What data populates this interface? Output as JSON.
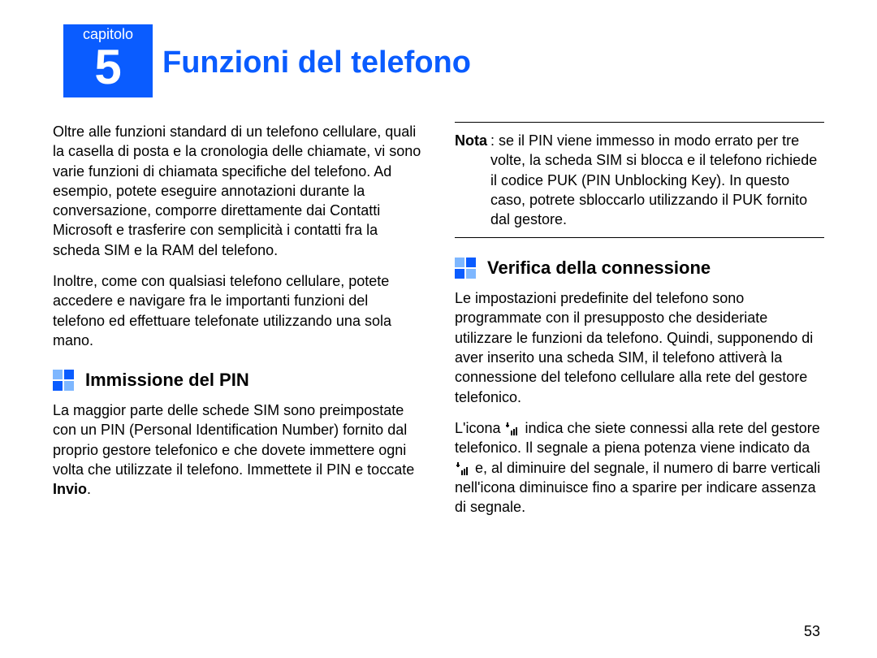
{
  "chapter": {
    "label": "capitolo",
    "number": "5"
  },
  "title": "Funzioni del telefono",
  "left": {
    "p1": "Oltre alle funzioni standard di un telefono cellulare, quali la casella di posta e la cronologia delle chiamate, vi sono varie funzioni di chiamata specifiche del telefono. Ad esempio, potete eseguire annotazioni durante la conversazione, comporre direttamente dai Contatti Microsoft e trasferire con semplicità i contatti fra la scheda SIM e la RAM del telefono.",
    "p2": "Inoltre, come con qualsiasi telefono cellulare, potete accedere e navigare fra le importanti funzioni del telefono ed effettuare telefonate utilizzando una sola mano.",
    "h2": "Immissione del PIN",
    "p3_a": "La maggior parte delle schede SIM sono preimpostate con un PIN (Personal Identification Number) fornito dal proprio gestore telefonico e che dovete immettere ogni volta che utilizzate il telefono. Immettete il PIN e toccate ",
    "p3_b": "Invio",
    "p3_c": "."
  },
  "right": {
    "note_label": "Nota",
    "note_text": ": se il PIN viene immesso in modo errato per tre volte, la scheda SIM si blocca e il telefono richiede il codice PUK (PIN Unblocking Key). In questo caso, potrete sbloccarlo utilizzando il PUK fornito dal gestore.",
    "h2": "Verifica della connessione",
    "p1": "Le impostazioni predefinite del telefono sono programmate con il presupposto che desideriate utilizzare le funzioni da telefono. Quindi, supponendo di aver inserito una scheda SIM, il telefono attiverà la connessione del telefono cellulare alla rete del gestore telefonico.",
    "p2_a": "L'icona ",
    "p2_b": " indica che siete connessi alla rete del gestore telefonico. Il segnale a piena potenza viene indicato da ",
    "p2_c": " e, al diminuire del segnale, il numero di barre verticali nell'icona diminuisce fino a sparire per indicare assenza di segnale."
  },
  "page_number": "53"
}
